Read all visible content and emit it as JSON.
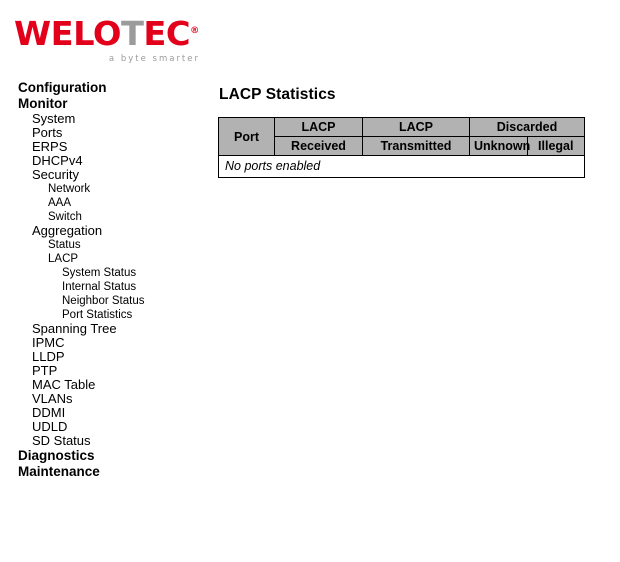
{
  "brand": {
    "wordmark_part1": "WEL",
    "wordmark_part2": "O",
    "wordmark_part3": "T",
    "wordmark_part4": "EC",
    "registered_mark": "®",
    "tagline": "a byte smarter",
    "red": "#e2001a",
    "gray": "#9b9b9b"
  },
  "sidebar": {
    "items": [
      {
        "label": "Configuration",
        "level": 0
      },
      {
        "label": "Monitor",
        "level": 0
      },
      {
        "label": "System",
        "level": 1
      },
      {
        "label": "Ports",
        "level": 1
      },
      {
        "label": "ERPS",
        "level": 1
      },
      {
        "label": "DHCPv4",
        "level": 1
      },
      {
        "label": "Security",
        "level": 1
      },
      {
        "label": "Network",
        "level": 2
      },
      {
        "label": "AAA",
        "level": 2
      },
      {
        "label": "Switch",
        "level": 2
      },
      {
        "label": "Aggregation",
        "level": 1
      },
      {
        "label": "Status",
        "level": 2
      },
      {
        "label": "LACP",
        "level": 2
      },
      {
        "label": "System Status",
        "level": 3
      },
      {
        "label": "Internal Status",
        "level": 3
      },
      {
        "label": "Neighbor Status",
        "level": 3
      },
      {
        "label": "Port Statistics",
        "level": 3
      },
      {
        "label": "Spanning Tree",
        "level": 1
      },
      {
        "label": "IPMC",
        "level": 1
      },
      {
        "label": "LLDP",
        "level": 1
      },
      {
        "label": "PTP",
        "level": 1
      },
      {
        "label": "MAC Table",
        "level": 1
      },
      {
        "label": "VLANs",
        "level": 1
      },
      {
        "label": "DDMI",
        "level": 1
      },
      {
        "label": "UDLD",
        "level": 1
      },
      {
        "label": "SD Status",
        "level": 1
      },
      {
        "label": "Diagnostics",
        "level": 0
      },
      {
        "label": "Maintenance",
        "level": 0
      }
    ]
  },
  "main": {
    "page_title": "LACP Statistics",
    "table": {
      "header_row1": {
        "port": "Port",
        "lacp_received": "LACP",
        "lacp_transmitted": "LACP",
        "discarded": "Discarded"
      },
      "header_row2": {
        "received": "Received",
        "transmitted": "Transmitted",
        "unknown": "Unknown",
        "illegal": "Illegal"
      },
      "empty_message": "No ports enabled",
      "rows": [],
      "header_bg": "#b2b2b2"
    }
  }
}
